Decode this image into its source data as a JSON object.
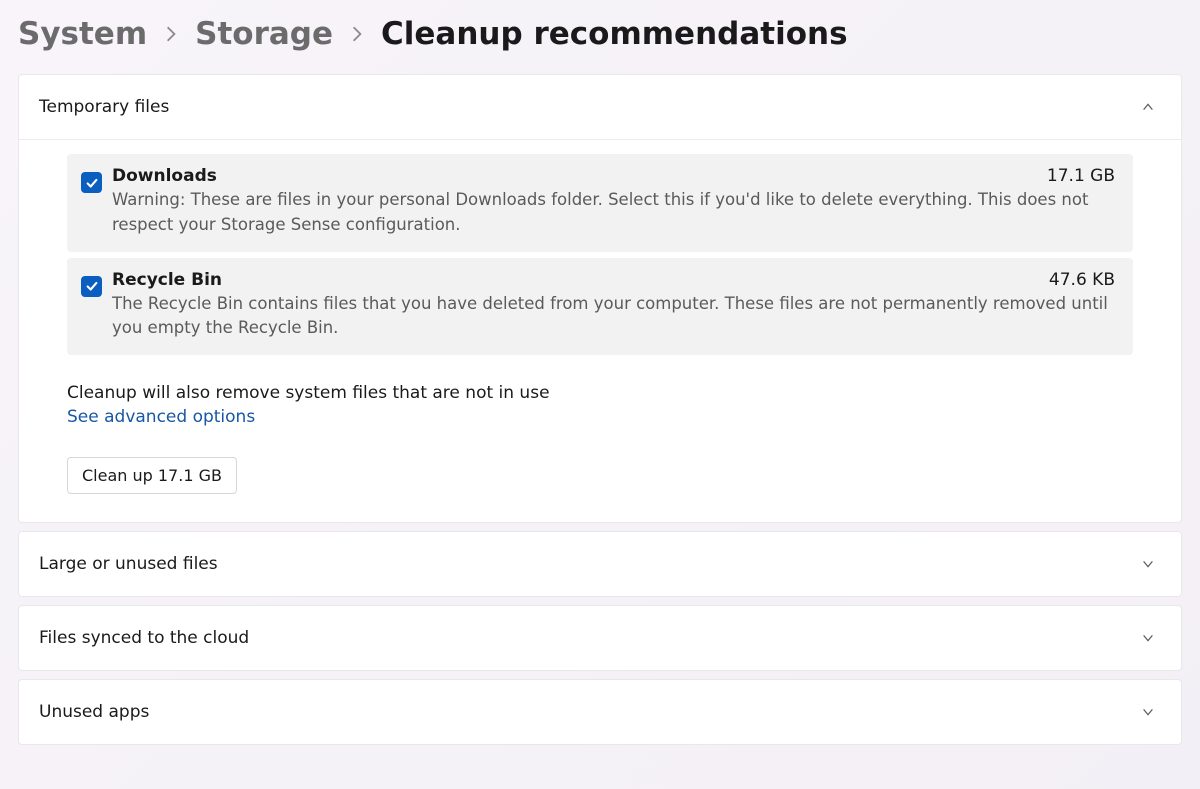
{
  "breadcrumb": {
    "level1": "System",
    "level2": "Storage",
    "current": "Cleanup recommendations"
  },
  "sections": {
    "temporary": {
      "title": "Temporary files",
      "items": [
        {
          "name": "Downloads",
          "size": "17.1 GB",
          "description": "Warning: These are files in your personal Downloads folder. Select this if you'd like to delete everything. This does not respect your Storage Sense configuration.",
          "checked": true
        },
        {
          "name": "Recycle Bin",
          "size": "47.6 KB",
          "description": "The Recycle Bin contains files that you have deleted from your computer. These files are not permanently removed until you empty the Recycle Bin.",
          "checked": true
        }
      ],
      "note": "Cleanup will also remove system files that are not in use",
      "advanced_link": "See advanced options",
      "cleanup_button": "Clean up 17.1 GB"
    },
    "large": {
      "title": "Large or unused files"
    },
    "cloud": {
      "title": "Files synced to the cloud"
    },
    "apps": {
      "title": "Unused apps"
    }
  }
}
